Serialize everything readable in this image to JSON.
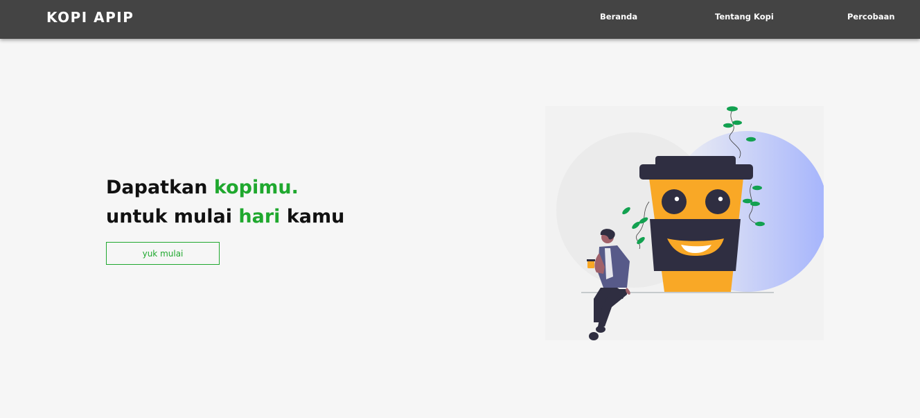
{
  "navbar": {
    "brand": "KOPI APIP",
    "links": [
      "Beranda",
      "Tentang Kopi",
      "Percobaan"
    ]
  },
  "hero": {
    "line1_prefix": "Dapatkan ",
    "line1_accent": "kopimu.",
    "line2_prefix": "untuk mulai ",
    "line2_accent": "hari",
    "line2_suffix": " kamu",
    "cta_label": "yuk mulai"
  },
  "illustration": {
    "subject": "coffee-cup-character-with-person"
  },
  "colors": {
    "navbar_bg": "#444444",
    "accent_green": "#1fa82e",
    "page_bg": "#f6f6f6",
    "cup_orange": "#f9a826",
    "cup_dark": "#2f2e41",
    "blob_blue": "#a5b4fc"
  }
}
